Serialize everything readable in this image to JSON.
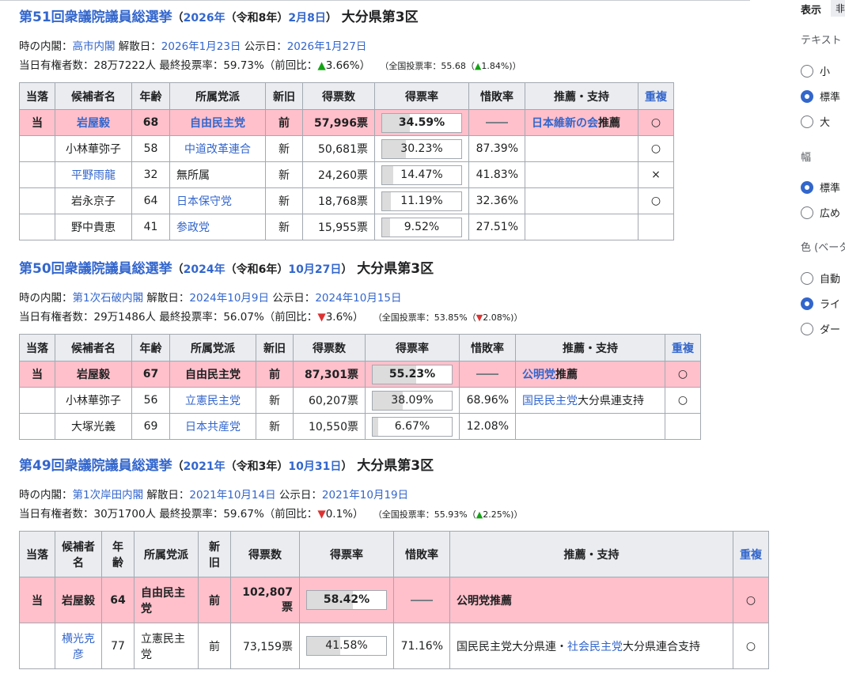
{
  "sidebar": {
    "title": "表示",
    "tab": "非",
    "text_group": "テキスト",
    "text_opts": [
      "小",
      "標準",
      "大"
    ],
    "width_group": "幅",
    "width_opts": [
      "標準",
      "広め"
    ],
    "color_group": "色 (ベータ",
    "color_opts": [
      "自動",
      "ライ",
      "ダー"
    ]
  },
  "e51": {
    "title": "第51回衆議院議員総選挙",
    "year": "2026年",
    "era": "（令和8年）",
    "date": "2月8日",
    "close": "）",
    "open": "（",
    "district": "大分県第3区",
    "cabinet_label": "時の内閣：",
    "cabinet": "高市内閣",
    "dissolve_label": "解散日：",
    "dissolve": "2026年1月23日",
    "announce_label": "公示日：",
    "announce": "2026年1月27日",
    "voters": "当日有権者数：28万7222人 最終投票率：59.73%（前回比：",
    "delta_arrow": "▲",
    "delta": "3.66%）",
    "nat_pre": "（全国投票率：55.68（",
    "nat_arrow": "▲",
    "nat_delta": "1.84%)）",
    "headers": [
      "当落",
      "候補者名",
      "年齢",
      "所属党派",
      "新旧",
      "得票数",
      "得票率",
      "惜敗率",
      "推薦・支持",
      "重複"
    ],
    "rows": [
      {
        "result": "当",
        "name": "岩屋毅",
        "age": "68",
        "party": "自由民主党",
        "status": "前",
        "votes": "57,996票",
        "share": "34.59%",
        "ratio": "――",
        "support": "日本維新の会",
        "support_suffix": "推薦",
        "dup": "○"
      },
      {
        "result": "",
        "name": "小林華弥子",
        "age": "58",
        "party": "中道改革連合",
        "status": "新",
        "votes": "50,681票",
        "share": "30.23%",
        "ratio": "87.39%",
        "support": "",
        "support_suffix": "",
        "dup": "○"
      },
      {
        "result": "",
        "name": "平野雨龍",
        "age": "32",
        "party": "無所属",
        "status": "新",
        "votes": "24,260票",
        "share": "14.47%",
        "ratio": "41.83%",
        "support": "",
        "support_suffix": "",
        "dup": "×"
      },
      {
        "result": "",
        "name": "岩永京子",
        "age": "64",
        "party": "日本保守党",
        "status": "新",
        "votes": "18,768票",
        "share": "11.19%",
        "ratio": "32.36%",
        "support": "",
        "support_suffix": "",
        "dup": "○"
      },
      {
        "result": "",
        "name": "野中貴恵",
        "age": "41",
        "party": "参政党",
        "status": "新",
        "votes": "15,955票",
        "share": "9.52%",
        "ratio": "27.51%",
        "support": "",
        "support_suffix": "",
        "dup": ""
      }
    ]
  },
  "e50": {
    "title": "第50回衆議院議員総選挙",
    "year": "2024年",
    "era": "（令和6年）",
    "date": "10月27日",
    "close": "）",
    "open": "（",
    "district": "大分県第3区",
    "cabinet_label": "時の内閣：",
    "cabinet": "第1次石破内閣",
    "dissolve_label": "解散日：",
    "dissolve": "2024年10月9日",
    "announce_label": "公示日：",
    "announce": "2024年10月15日",
    "voters": "当日有権者数：29万1486人 最終投票率：56.07%（前回比：",
    "delta_arrow": "▼",
    "delta": "3.6%）",
    "nat_pre": "（全国投票率：53.85%（",
    "nat_arrow": "▼",
    "nat_delta": "2.08%)）",
    "headers": [
      "当落",
      "候補者名",
      "年齢",
      "所属党派",
      "新旧",
      "得票数",
      "得票率",
      "惜敗率",
      "推薦・支持",
      "重複"
    ],
    "rows": [
      {
        "result": "当",
        "name": "岩屋毅",
        "age": "67",
        "party": "自由民主党",
        "status": "前",
        "votes": "87,301票",
        "share": "55.23%",
        "ratio": "――",
        "support": "公明党",
        "support_suffix": "推薦",
        "dup": "○"
      },
      {
        "result": "",
        "name": "小林華弥子",
        "age": "56",
        "party": "立憲民主党",
        "status": "新",
        "votes": "60,207票",
        "share": "38.09%",
        "ratio": "68.96%",
        "support": "国民民主党",
        "support_suffix": "大分県連支持",
        "dup": "○"
      },
      {
        "result": "",
        "name": "大塚光義",
        "age": "69",
        "party": "日本共産党",
        "status": "新",
        "votes": "10,550票",
        "share": "6.67%",
        "ratio": "12.08%",
        "support": "",
        "support_suffix": "",
        "dup": ""
      }
    ]
  },
  "e49": {
    "title": "第49回衆議院議員総選挙",
    "year": "2021年",
    "era": "（令和3年）",
    "date": "10月31日",
    "close": "）",
    "open": "（",
    "district": "大分県第3区",
    "cabinet_label": "時の内閣：",
    "cabinet": "第1次岸田内閣",
    "dissolve_label": "解散日：",
    "dissolve": "2021年10月14日",
    "announce_label": "公示日：",
    "announce": "2021年10月19日",
    "voters": "当日有権者数：30万1700人 最終投票率：59.67%（前回比：",
    "delta_arrow": "▼",
    "delta": "0.1%）",
    "nat_pre": "（全国投票率：55.93%（",
    "nat_arrow": "▲",
    "nat_delta": "2.25%)）",
    "headers": [
      "当落",
      "候補者名",
      "年齢",
      "所属党派",
      "新旧",
      "得票数",
      "得票率",
      "惜敗率",
      "推薦・支持",
      "重複"
    ],
    "rows": [
      {
        "result": "当",
        "name": "岩屋毅",
        "age": "64",
        "party": "自由民主党",
        "status": "前",
        "votes": "102,807票",
        "share": "58.42%",
        "ratio": "――",
        "support": "公明党推薦",
        "dup": "○"
      },
      {
        "result": "",
        "name": "横光克彦",
        "age": "77",
        "party": "立憲民主党",
        "status": "前",
        "votes": "73,159票",
        "share": "41.58%",
        "ratio": "71.16%",
        "support_a": "国民民主党大分県連・",
        "support_link": "社会民主党",
        "support_b": "大分県連合支持",
        "dup": "○"
      }
    ]
  }
}
